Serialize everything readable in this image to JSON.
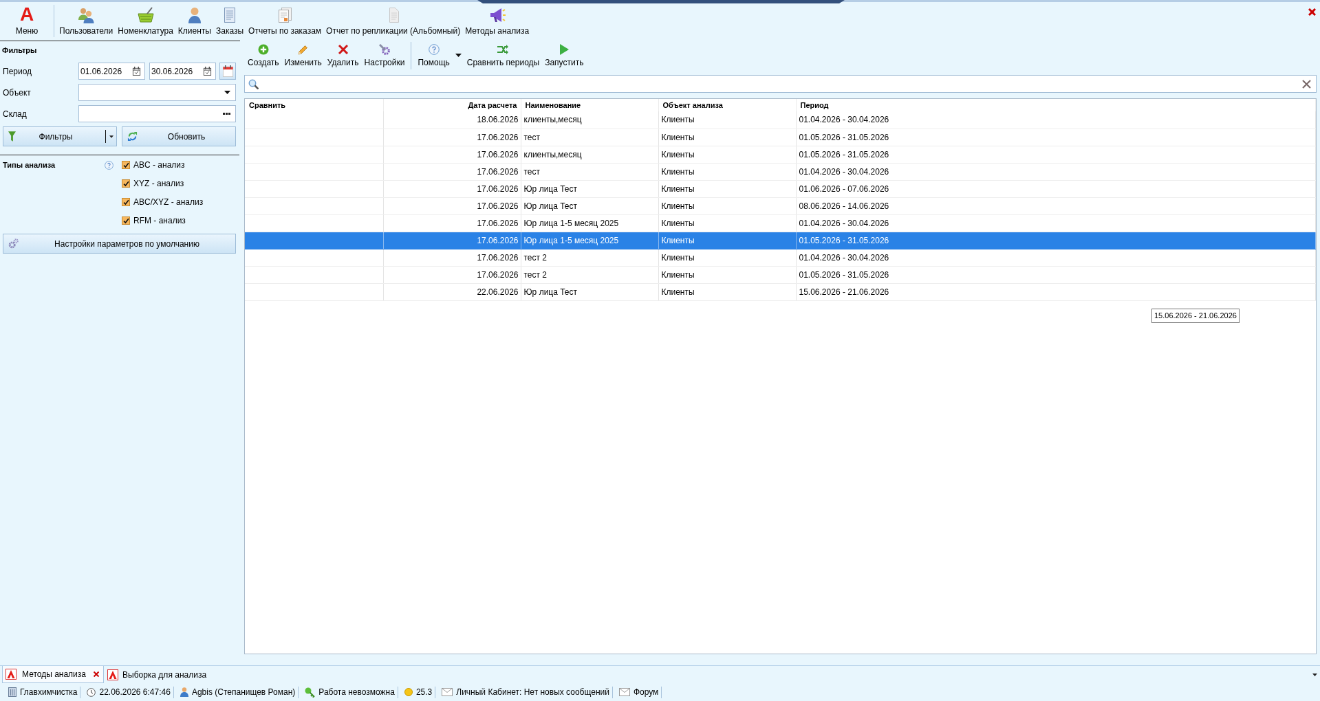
{
  "ribbon": {
    "logo": "A",
    "menu_label": "Меню",
    "items": [
      {
        "label": "Пользователи"
      },
      {
        "label": "Номенклатура"
      },
      {
        "label": "Клиенты"
      },
      {
        "label": "Заказы"
      },
      {
        "label": "Отчеты по заказам"
      },
      {
        "label": "Отчет по репликации (Альбомный)"
      },
      {
        "label": "Методы анализа"
      }
    ]
  },
  "filters": {
    "title": "Фильтры",
    "period": {
      "label": "Период",
      "from": "01.06.2026",
      "to": "30.06.2026"
    },
    "object": {
      "label": "Объект"
    },
    "warehouse": {
      "label": "Склад"
    },
    "filter_button": "Фильтры",
    "refresh_button": "Обновить"
  },
  "analysis_types": {
    "title": "Типы анализа",
    "options": [
      {
        "label": "ABC - анализ",
        "checked": true
      },
      {
        "label": "XYZ - анализ",
        "checked": true
      },
      {
        "label": "ABC/XYZ - анализ",
        "checked": true
      },
      {
        "label": "RFM - анализ",
        "checked": true
      }
    ]
  },
  "defaults_button": "Настройки параметров по умолчанию",
  "toolbar": {
    "groups": [
      {
        "items": [
          {
            "label": "Создать",
            "kind": "button"
          },
          {
            "label": "Изменить",
            "kind": "button"
          },
          {
            "label": "Удалить",
            "kind": "button"
          },
          {
            "label": "Настройки",
            "kind": "button"
          }
        ]
      },
      {
        "items": [
          {
            "label": "Помощь",
            "kind": "dropdown"
          },
          {
            "label": "Сравнить периоды",
            "kind": "button"
          },
          {
            "label": "Запустить",
            "kind": "button"
          }
        ]
      }
    ]
  },
  "table": {
    "columns": [
      "Сравнить",
      "Дата расчета",
      "Наименование",
      "Объект анализа",
      "Период"
    ],
    "rows": [
      {
        "date": "18.06.2026",
        "name": "клиенты,месяц",
        "object": "Клиенты",
        "period": "01.04.2026 - 30.04.2026",
        "selected": false
      },
      {
        "date": "17.06.2026",
        "name": "тест",
        "object": "Клиенты",
        "period": "01.05.2026 - 31.05.2026",
        "selected": false
      },
      {
        "date": "17.06.2026",
        "name": "клиенты,месяц",
        "object": "Клиенты",
        "period": "01.05.2026 - 31.05.2026",
        "selected": false
      },
      {
        "date": "17.06.2026",
        "name": "тест",
        "object": "Клиенты",
        "period": "01.04.2026 - 30.04.2026",
        "selected": false
      },
      {
        "date": "17.06.2026",
        "name": "Юр лица Тест",
        "object": "Клиенты",
        "period": "01.06.2026 - 07.06.2026",
        "selected": false
      },
      {
        "date": "17.06.2026",
        "name": "Юр лица Тест",
        "object": "Клиенты",
        "period": "08.06.2026 - 14.06.2026",
        "selected": false
      },
      {
        "date": "17.06.2026",
        "name": "Юр лица 1-5 месяц 2025",
        "object": "Клиенты",
        "period": "01.04.2026 - 30.04.2026",
        "selected": false
      },
      {
        "date": "17.06.2026",
        "name": "Юр лица 1-5 месяц 2025",
        "object": "Клиенты",
        "period": "01.05.2026 - 31.05.2026",
        "selected": true
      },
      {
        "date": "17.06.2026",
        "name": "тест 2",
        "object": "Клиенты",
        "period": "01.04.2026 - 30.04.2026",
        "selected": false
      },
      {
        "date": "17.06.2026",
        "name": "тест 2",
        "object": "Клиенты",
        "period": "01.05.2026 - 31.05.2026",
        "selected": false
      },
      {
        "date": "22.06.2026",
        "name": "Юр лица Тест",
        "object": "Клиенты",
        "period": "15.06.2026 - 21.06.2026",
        "selected": false
      }
    ]
  },
  "tooltip": "15.06.2026 - 21.06.2026",
  "document_tabs": [
    {
      "label": "Методы анализа",
      "selected": true
    },
    {
      "label": "Выборка для анализа",
      "selected": false
    }
  ],
  "status_bar": {
    "items": [
      {
        "text": "Главхимчистка"
      },
      {
        "text": "22.06.2026 6:47:46"
      },
      {
        "text": "Agbis (Степанищев Роман)"
      },
      {
        "text": "Работа невозможна"
      },
      {
        "text": "25.3"
      },
      {
        "text": "Личный Кабинет: Нет новых сообщений"
      },
      {
        "text": "Форум"
      }
    ]
  }
}
